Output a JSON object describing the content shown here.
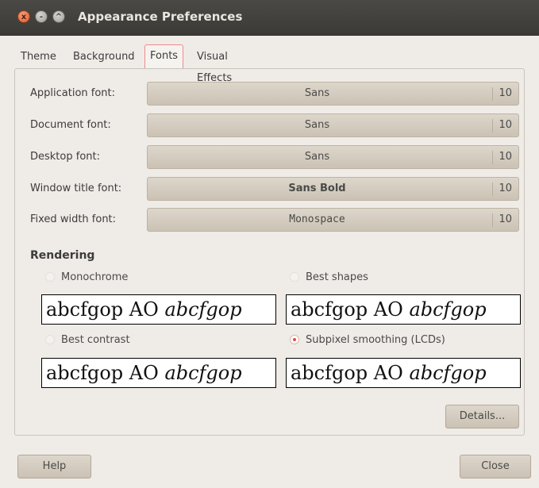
{
  "window": {
    "title": "Appearance Preferences",
    "buttons": {
      "close": "x",
      "minimize": "-",
      "maximize": "^"
    }
  },
  "tabs": [
    {
      "label": "Theme",
      "active": false
    },
    {
      "label": "Background",
      "active": false
    },
    {
      "label": "Fonts",
      "active": true
    },
    {
      "label": "Visual Effects",
      "active": false
    }
  ],
  "fonts": [
    {
      "label": "Application font:",
      "font": "Sans",
      "size": "10"
    },
    {
      "label": "Document font:",
      "font": "Sans",
      "size": "10"
    },
    {
      "label": "Desktop font:",
      "font": "Sans",
      "size": "10"
    },
    {
      "label": "Window title font:",
      "font": "Sans Bold",
      "size": "10"
    },
    {
      "label": "Fixed width font:",
      "font": "Monospace",
      "size": "10"
    }
  ],
  "rendering": {
    "heading": "Rendering",
    "options": [
      {
        "label": "Monochrome",
        "selected": false,
        "sample_regular": "abcfgop AO ",
        "sample_italic": "abcfgop"
      },
      {
        "label": "Best shapes",
        "selected": false,
        "sample_regular": "abcfgop AO ",
        "sample_italic": "abcfgop"
      },
      {
        "label": "Best contrast",
        "selected": false,
        "sample_regular": "abcfgop AO ",
        "sample_italic": "abcfgop"
      },
      {
        "label": "Subpixel smoothing (LCDs)",
        "selected": true,
        "sample_regular": "abcfgop AO ",
        "sample_italic": "abcfgop"
      }
    ]
  },
  "details_label": "Details...",
  "help_label": "Help",
  "close_label": "Close",
  "colors": {
    "titlebar": "#3b3a36",
    "window_bg": "#efebe7",
    "accent": "#e0503a"
  }
}
